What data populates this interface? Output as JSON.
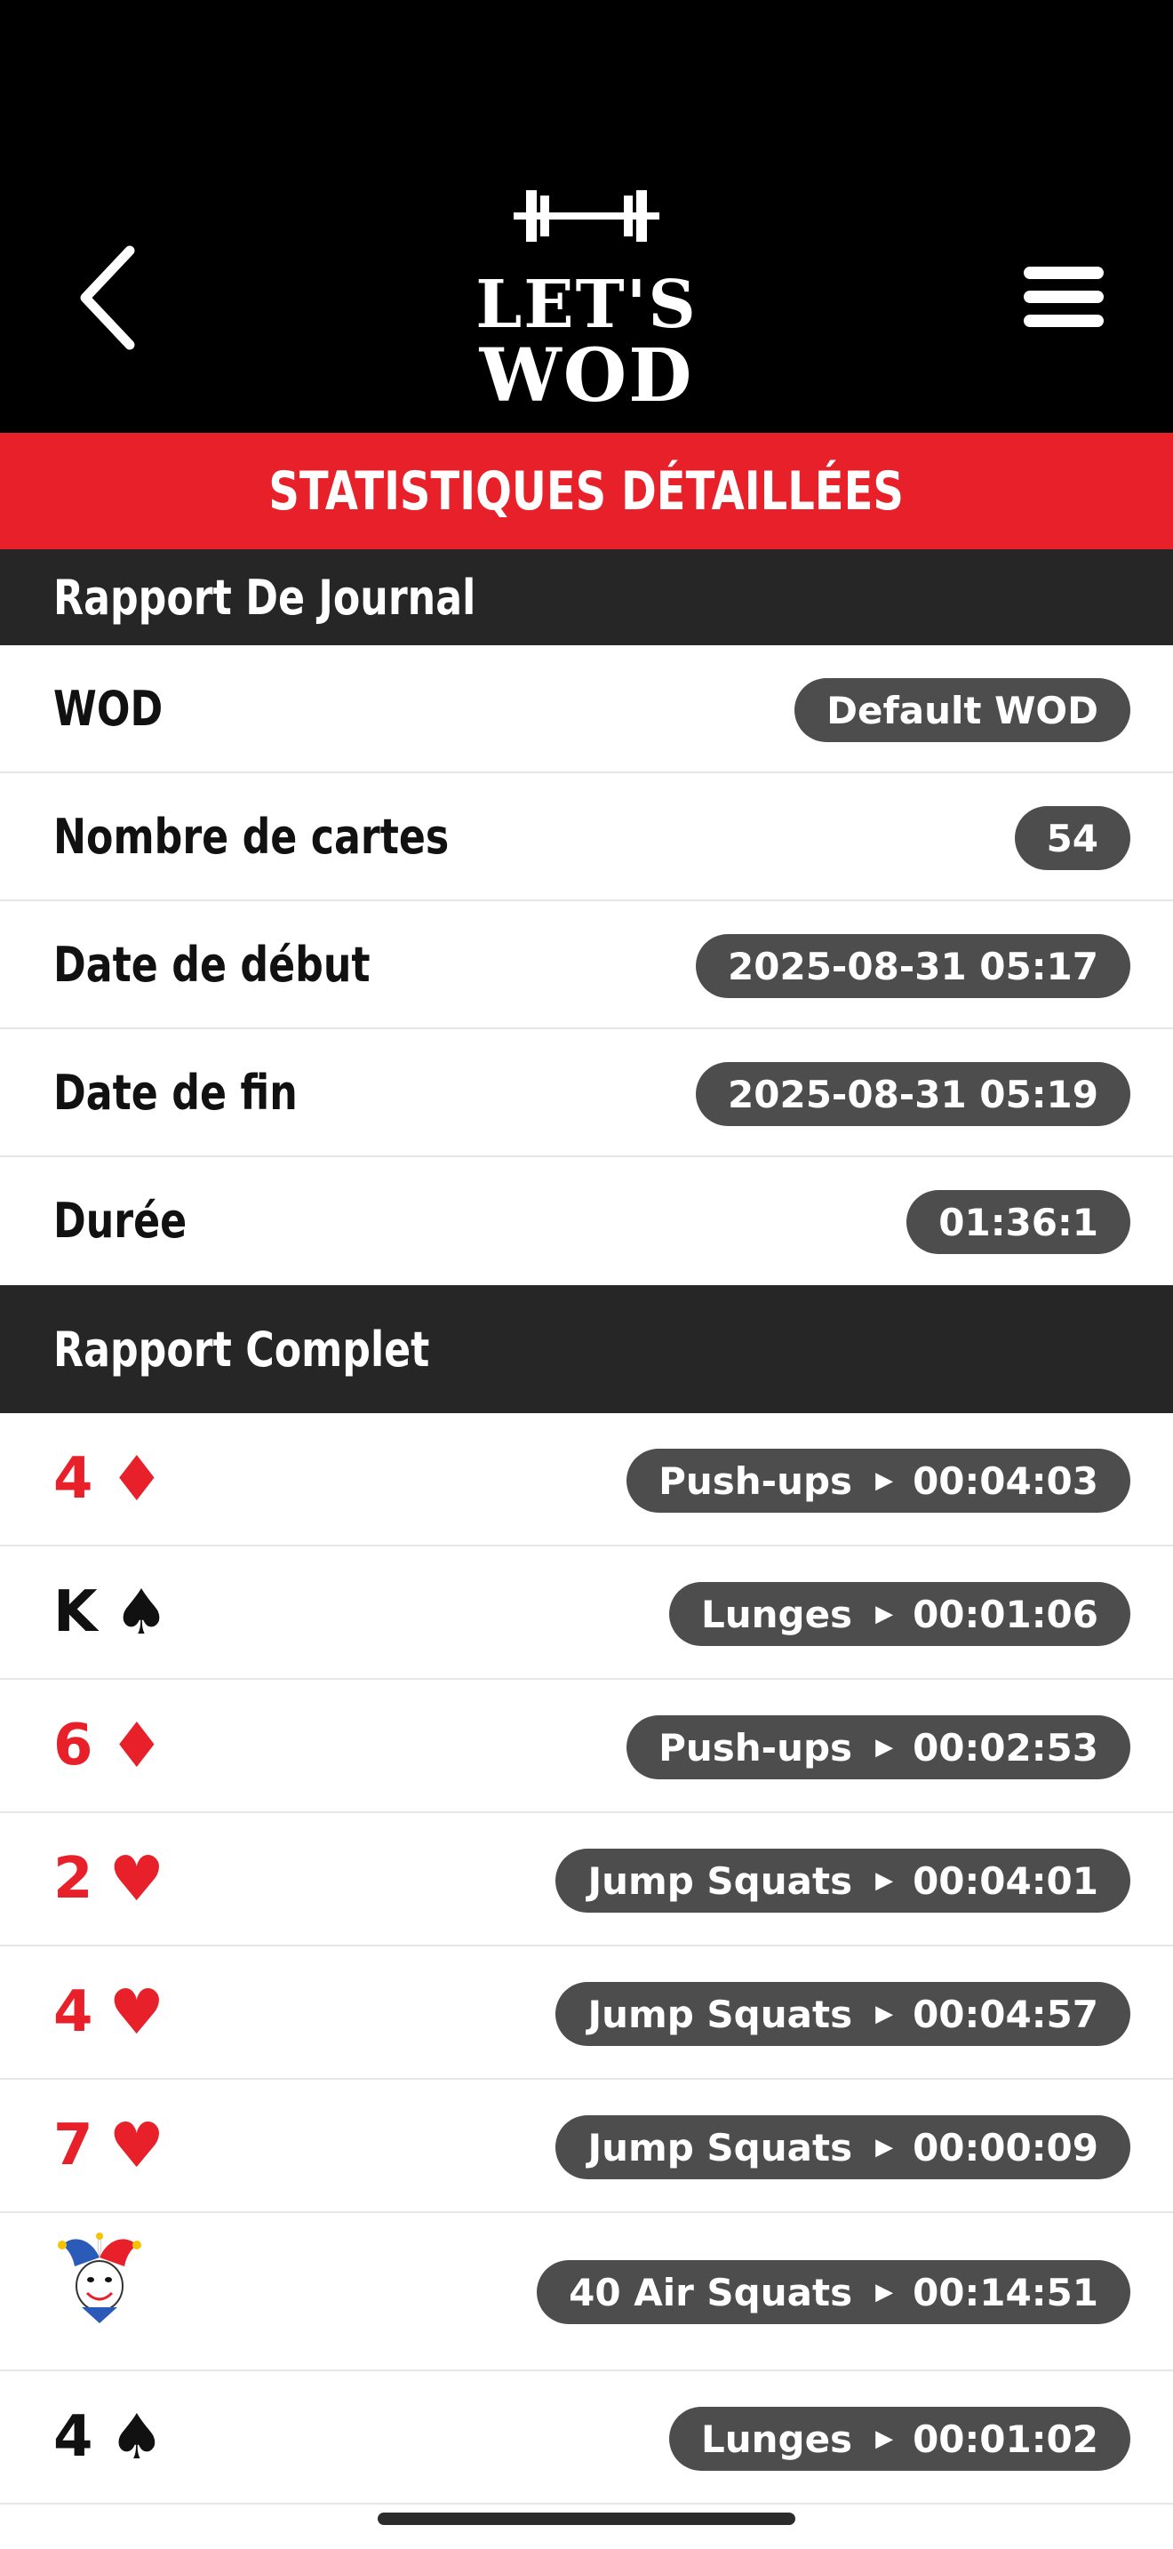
{
  "header": {
    "logo_line1": "LET'S",
    "logo_line2": "WOD",
    "back_icon": "chevron-left-icon",
    "menu_icon": "hamburger-menu-icon"
  },
  "banner": {
    "title": "STATISTIQUES DÉTAILLÉES",
    "color": "#e8202a"
  },
  "journal": {
    "title": "Rapport De Journal",
    "rows": [
      {
        "label": "WOD",
        "value": "Default WOD"
      },
      {
        "label": "Nombre de cartes",
        "value": "54"
      },
      {
        "label": "Date de début",
        "value": "2025-08-31 05:17"
      },
      {
        "label": "Date de fin",
        "value": "2025-08-31 05:19"
      },
      {
        "label": "Durée",
        "value": "01:36:1"
      }
    ]
  },
  "complete": {
    "title": "Rapport Complet",
    "cards": [
      {
        "rank": "4",
        "suit": "♦",
        "color": "red",
        "exercise": "Push-ups",
        "time": "00:04:03"
      },
      {
        "rank": "K",
        "suit": "♠",
        "color": "black",
        "exercise": "Lunges",
        "time": "00:01:06"
      },
      {
        "rank": "6",
        "suit": "♦",
        "color": "red",
        "exercise": "Push-ups",
        "time": "00:02:53"
      },
      {
        "rank": "2",
        "suit": "♥",
        "color": "red",
        "exercise": "Jump Squats",
        "time": "00:04:01"
      },
      {
        "rank": "4",
        "suit": "♥",
        "color": "red",
        "exercise": "Jump Squats",
        "time": "00:04:57"
      },
      {
        "rank": "7",
        "suit": "♥",
        "color": "red",
        "exercise": "Jump Squats",
        "time": "00:00:09"
      },
      {
        "rank": "",
        "suit": "",
        "color": "joker",
        "exercise": "40 Air Squats",
        "time": "00:14:51"
      },
      {
        "rank": "4",
        "suit": "♠",
        "color": "black",
        "exercise": "Lunges",
        "time": "00:01:02"
      }
    ]
  }
}
